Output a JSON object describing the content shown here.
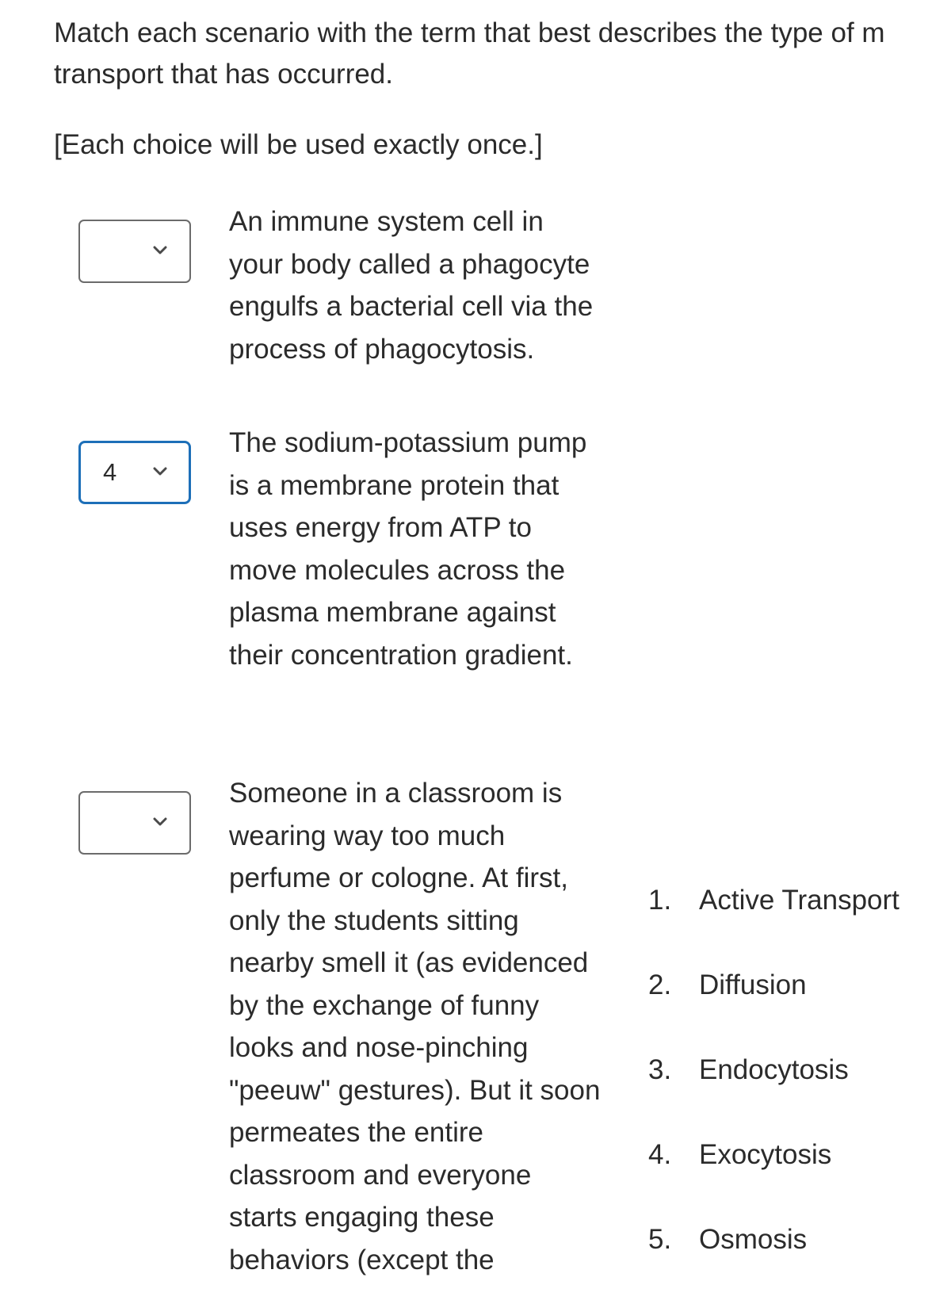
{
  "question": {
    "prompt_line1": "Match each scenario with the term that best describes the type of m",
    "prompt_line2": "transport that has occurred.",
    "note": "[Each choice will be used exactly once.]"
  },
  "scenarios": [
    {
      "selected_value": "",
      "text": "An immune system cell in your body called a phagocyte engulfs a bacterial cell via the process of phagocytosis.",
      "focused": false
    },
    {
      "selected_value": "4",
      "text": "The sodium-potassium pump is a membrane protein that uses energy from ATP to move molecules across the plasma membrane against their concentration gradient.",
      "focused": true
    },
    {
      "selected_value": "",
      "text": "Someone in a classroom is wearing way too much perfume or cologne. At first, only the students sitting nearby smell it (as evidenced by the exchange of funny looks and nose-pinching \"peeuw\" gestures). But it soon permeates the entire classroom and everyone starts engaging these behaviors (except the",
      "focused": false
    }
  ],
  "choices": [
    {
      "number": "1.",
      "label": "Active Transport"
    },
    {
      "number": "2.",
      "label": "Diffusion"
    },
    {
      "number": "3.",
      "label": "Endocytosis"
    },
    {
      "number": "4.",
      "label": "Exocytosis"
    },
    {
      "number": "5.",
      "label": "Osmosis"
    }
  ],
  "colors": {
    "focus_border": "#1d6fb8",
    "default_border": "#6b6b6b",
    "text": "#2b2b2b"
  }
}
